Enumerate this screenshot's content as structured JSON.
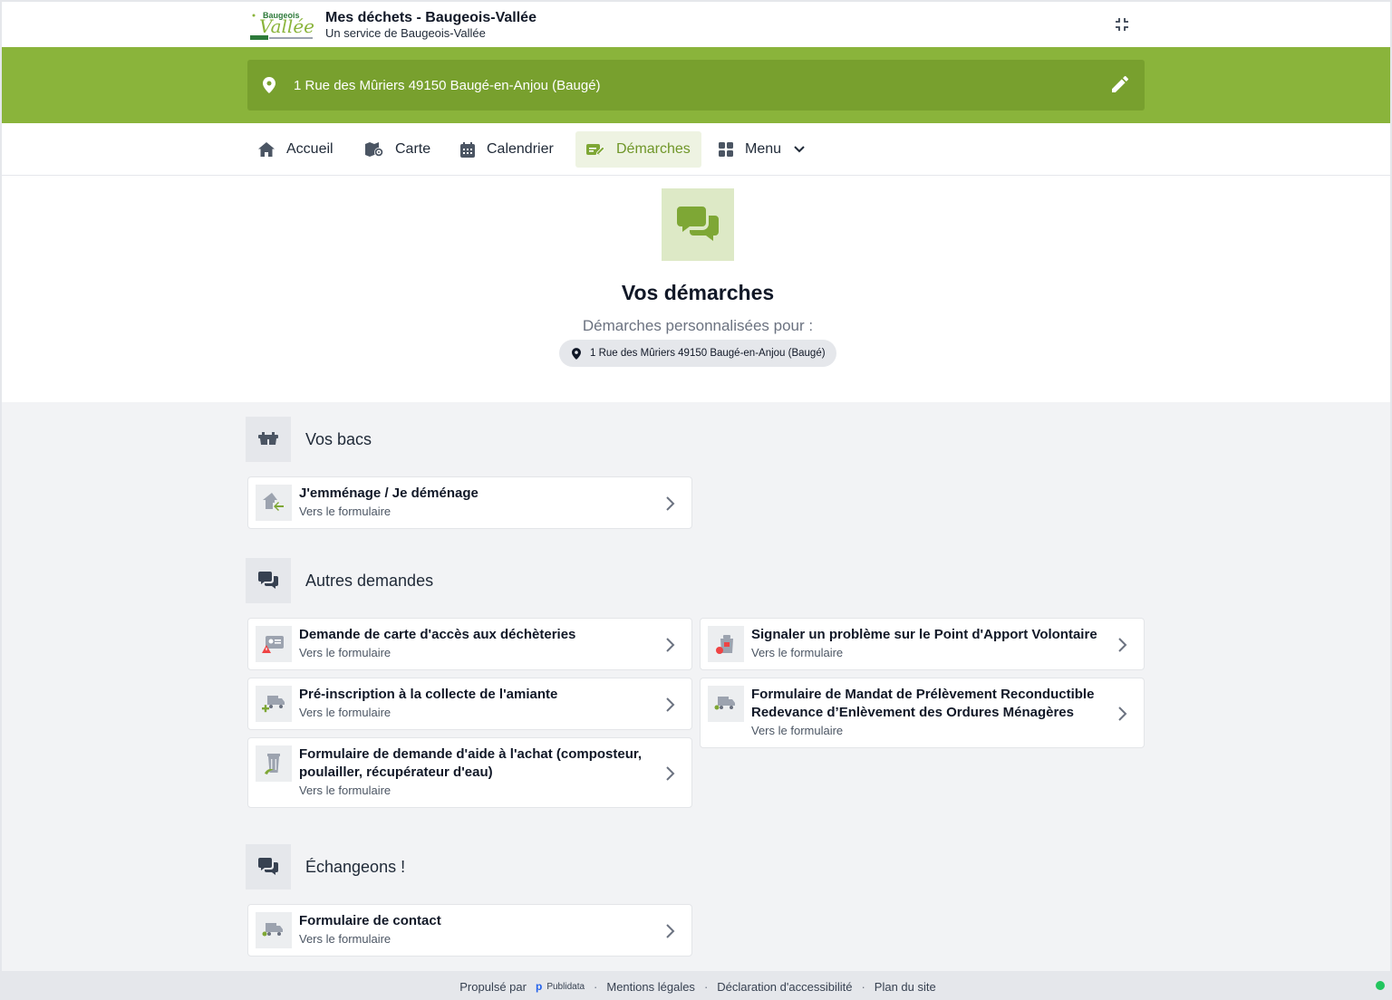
{
  "header": {
    "logo_text": "Baugeois Vallée",
    "app_title": "Mes déchets - Baugeois-Vallée",
    "app_subtitle": "Un service de Baugeois-Vallée",
    "fullscreen_icon": "collapse-icon"
  },
  "address_bar": {
    "address": "1 Rue des Mûriers 49150 Baugé-en-Anjou (Baugé)",
    "icons": [
      "map-pin-icon",
      "pencil-icon"
    ]
  },
  "nav": {
    "items": [
      {
        "label": "Accueil",
        "icon": "home-icon",
        "active": false
      },
      {
        "label": "Carte",
        "icon": "map-icon",
        "active": false
      },
      {
        "label": "Calendrier",
        "icon": "calendar-icon",
        "active": false
      },
      {
        "label": "Démarches",
        "icon": "form-edit-icon",
        "active": true
      },
      {
        "label": "Menu",
        "icon": "grid-icon",
        "active": false
      }
    ]
  },
  "hero": {
    "title": "Vos démarches",
    "subtitle": "Démarches personnalisées pour :",
    "chip_address": "1 Rue des Mûriers 49150 Baugé-en-Anjou (Baugé)"
  },
  "sections": [
    {
      "title": "Vos bacs",
      "icon": "bins-icon",
      "cards": [
        {
          "title": "J'emménage / Je déménage",
          "subtitle": "Vers le formulaire",
          "icon": "house-move-icon"
        }
      ]
    },
    {
      "title": "Autres demandes",
      "icon": "chat-icon",
      "cards": [
        {
          "title": "Demande de carte d'accès aux déchèteries",
          "subtitle": "Vers le formulaire",
          "icon": "access-card-icon"
        },
        {
          "title": "Signaler un problème sur le Point d'Apport Volontaire",
          "subtitle": "Vers le formulaire",
          "icon": "container-alert-icon"
        },
        {
          "title": "Pré-inscription à la collecte de l'amiante",
          "subtitle": "Vers le formulaire",
          "icon": "truck-plus-icon"
        },
        {
          "title": "Formulaire de Mandat de Prélèvement Reconductible Redevance d’Enlèvement des Ordures Ménagères",
          "subtitle": "Vers le formulaire",
          "icon": "truck-icon"
        },
        {
          "title": "Formulaire de demande d'aide à l'achat (composteur, poulailler, récupérateur d'eau)",
          "subtitle": "Vers le formulaire",
          "icon": "composter-icon"
        }
      ]
    },
    {
      "title": "Échangeons !",
      "icon": "chat-icon",
      "cards": [
        {
          "title": "Formulaire de contact",
          "subtitle": "Vers le formulaire",
          "icon": "truck-icon"
        }
      ]
    }
  ],
  "footer": {
    "powered_by": "Propulsé par",
    "brand": "Publidata",
    "links": [
      "Mentions légales",
      "Déclaration d'accessibilité",
      "Plan du site"
    ],
    "status_color": "#22c55e"
  },
  "colors": {
    "brand_green": "#8ab43b",
    "brand_green_dark": "#78a02e",
    "active_green": "#6f9628"
  }
}
